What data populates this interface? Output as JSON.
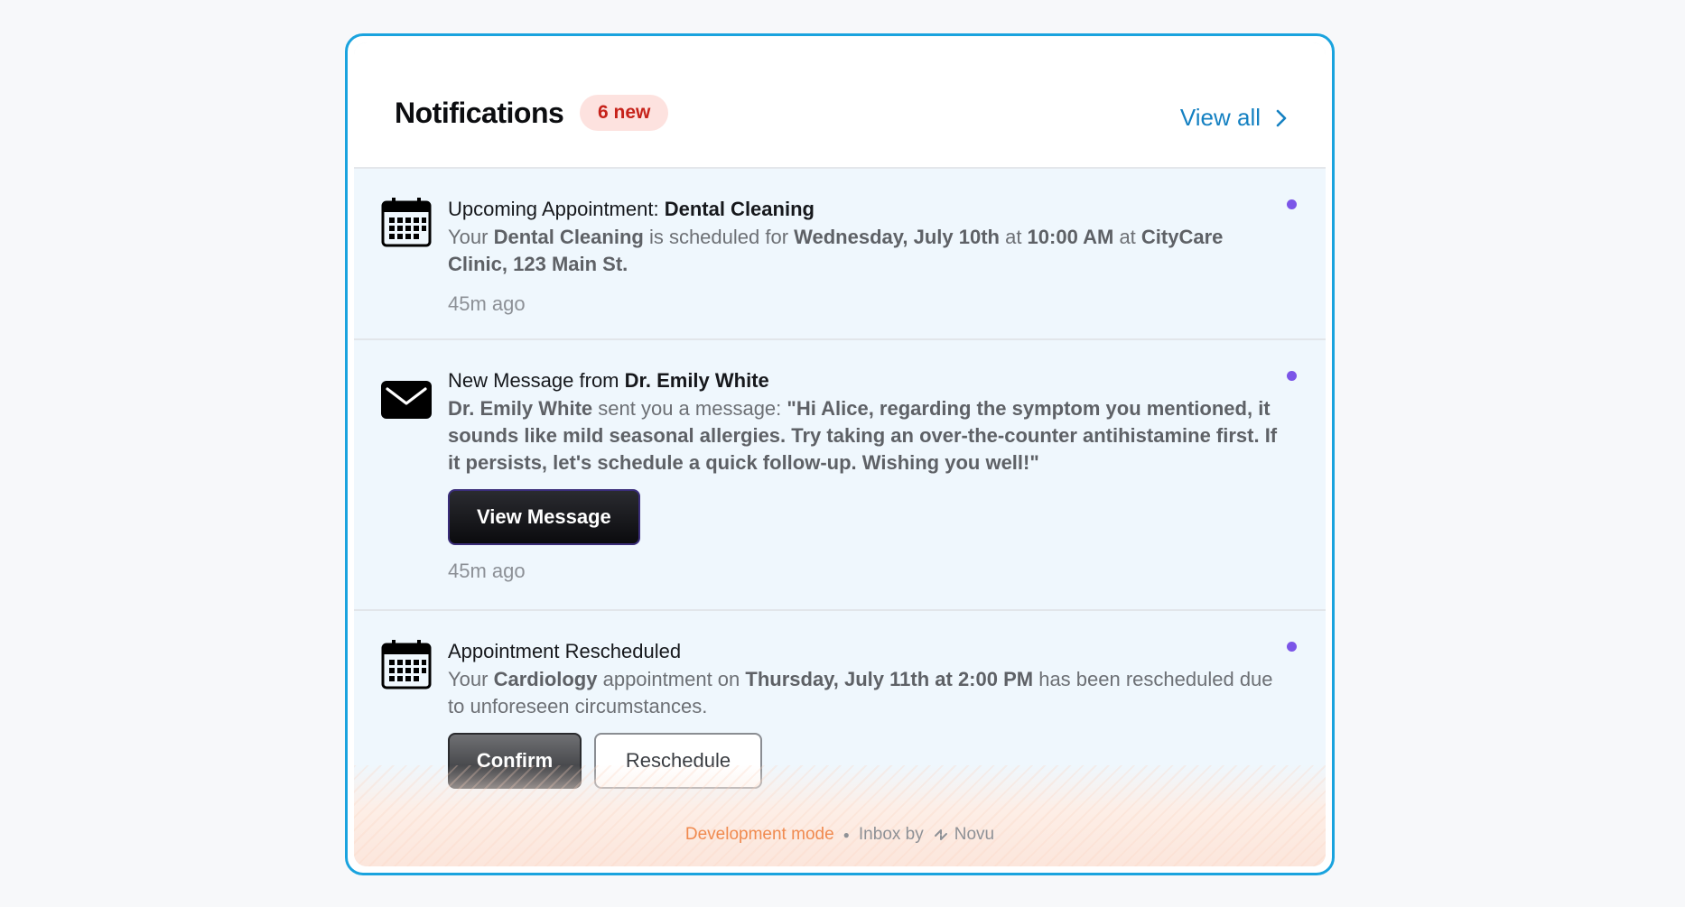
{
  "header": {
    "title": "Notifications",
    "badge": "6 new",
    "view_all": "View all"
  },
  "notifications": [
    {
      "icon": "calendar-icon",
      "title_prefix": "Upcoming Appointment: ",
      "title_bold": "Dental Cleaning",
      "body": [
        {
          "t": "Your ",
          "b": false
        },
        {
          "t": "Dental Cleaning",
          "b": true
        },
        {
          "t": " is scheduled for ",
          "b": false
        },
        {
          "t": "Wednesday, July 10th",
          "b": true
        },
        {
          "t": " at ",
          "b": false
        },
        {
          "t": "10:00 AM",
          "b": true
        },
        {
          "t": " at ",
          "b": false
        },
        {
          "t": "CityCare Clinic, 123 Main St.",
          "b": true
        }
      ],
      "time": "45m ago",
      "unread": true
    },
    {
      "icon": "envelope-icon",
      "title_prefix": "New Message from ",
      "title_bold": "Dr. Emily White",
      "body": [
        {
          "t": "Dr. Emily White",
          "b": true
        },
        {
          "t": " sent you a message: ",
          "b": false
        },
        {
          "t": "\"Hi Alice, regarding the symptom you mentioned, it sounds like mild seasonal allergies. Try taking an over-the-counter antihistamine first. If it persists, let's schedule a quick follow-up. Wishing you well!\"",
          "b": true
        }
      ],
      "primary_action": "View Message",
      "time": "45m ago",
      "unread": true
    },
    {
      "icon": "calendar-icon",
      "title_prefix": "Appointment Rescheduled",
      "title_bold": "",
      "body": [
        {
          "t": "Your ",
          "b": false
        },
        {
          "t": "Cardiology",
          "b": true
        },
        {
          "t": " appointment on ",
          "b": false
        },
        {
          "t": "Thursday, July 11th at 2:00 PM",
          "b": true
        },
        {
          "t": " has been rescheduled due to unforeseen circumstances.",
          "b": false
        }
      ],
      "primary_action": "Confirm",
      "secondary_action": "Reschedule",
      "unread": true
    }
  ],
  "footer": {
    "mode": "Development mode",
    "inbox_by": "Inbox by",
    "brand": "Novu"
  },
  "colors": {
    "accent": "#1581c2",
    "badge_bg": "#fde2df",
    "badge_text": "#c6221a",
    "unread_dot": "#7b55e8",
    "item_bg": "#eff7fd",
    "dev_mode": "#f08a4f"
  }
}
